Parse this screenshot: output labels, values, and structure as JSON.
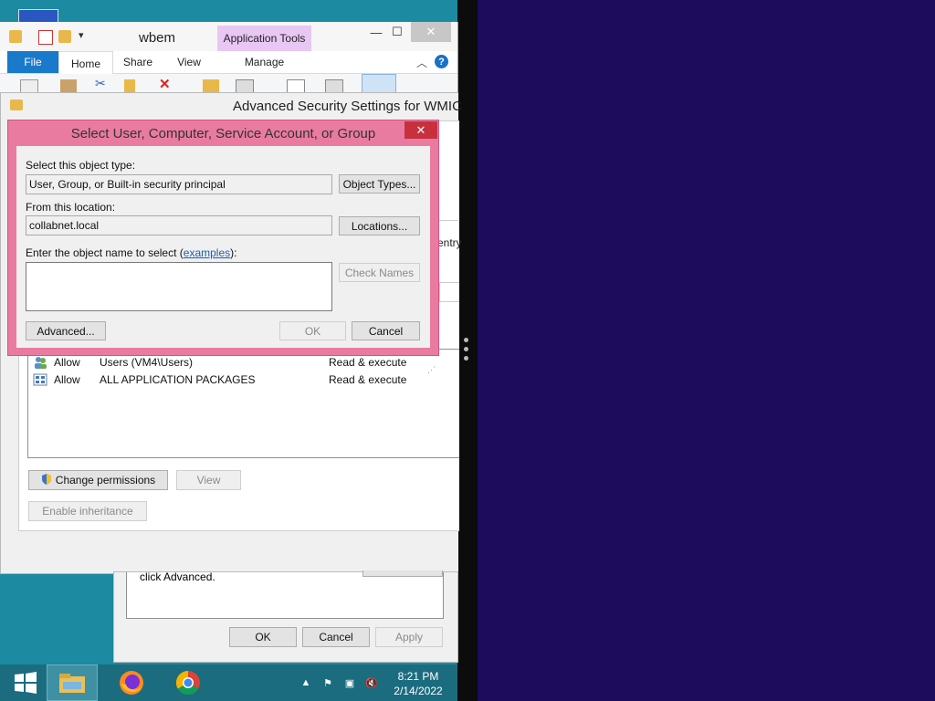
{
  "explorer": {
    "title": "wbem",
    "contextual_tab": "Application Tools",
    "tabs": [
      "File",
      "Home",
      "Share",
      "View",
      "Manage"
    ],
    "help": "?"
  },
  "advanced_security": {
    "title": "Advanced Security Settings for WMIC",
    "partial_text": "entry",
    "permission_entries": [
      {
        "type": "Allow",
        "principal": "Users (VM4\\Users)",
        "access": "Read & execute"
      },
      {
        "type": "Allow",
        "principal": "ALL APPLICATION PACKAGES",
        "access": "Read & execute"
      }
    ],
    "change_permissions": "Change permissions",
    "view": "View",
    "enable_inheritance": "Enable inheritance"
  },
  "properties_dialog": {
    "hint": "click Advanced.",
    "ok": "OK",
    "cancel": "Cancel",
    "apply": "Apply"
  },
  "select_dialog": {
    "title": "Select User, Computer, Service Account, or Group",
    "close": "✕",
    "object_type_label": "Select this object type:",
    "object_type_value": "User, Group, or Built-in security principal",
    "object_types_button": "Object Types...",
    "location_label": "From this location:",
    "location_value": "collabnet.local",
    "locations_button": "Locations...",
    "enter_label_prefix": "Enter the object name to select (",
    "examples_link": "examples",
    "enter_label_suffix": "):",
    "object_name_value": "",
    "check_names_button": "Check Names",
    "advanced_button": "Advanced...",
    "ok_button": "OK",
    "cancel_button": "Cancel"
  },
  "taskbar": {
    "time": "8:21 PM",
    "date": "2/14/2022",
    "pinned": [
      "file-explorer",
      "firefox",
      "chrome"
    ]
  },
  "colors": {
    "desktop_left": "#1c8aa0",
    "desktop_right": "#1d0b5c",
    "dialog_accent": "#e97ba1",
    "close_red": "#c8303e",
    "file_tab_blue": "#1979ca"
  }
}
